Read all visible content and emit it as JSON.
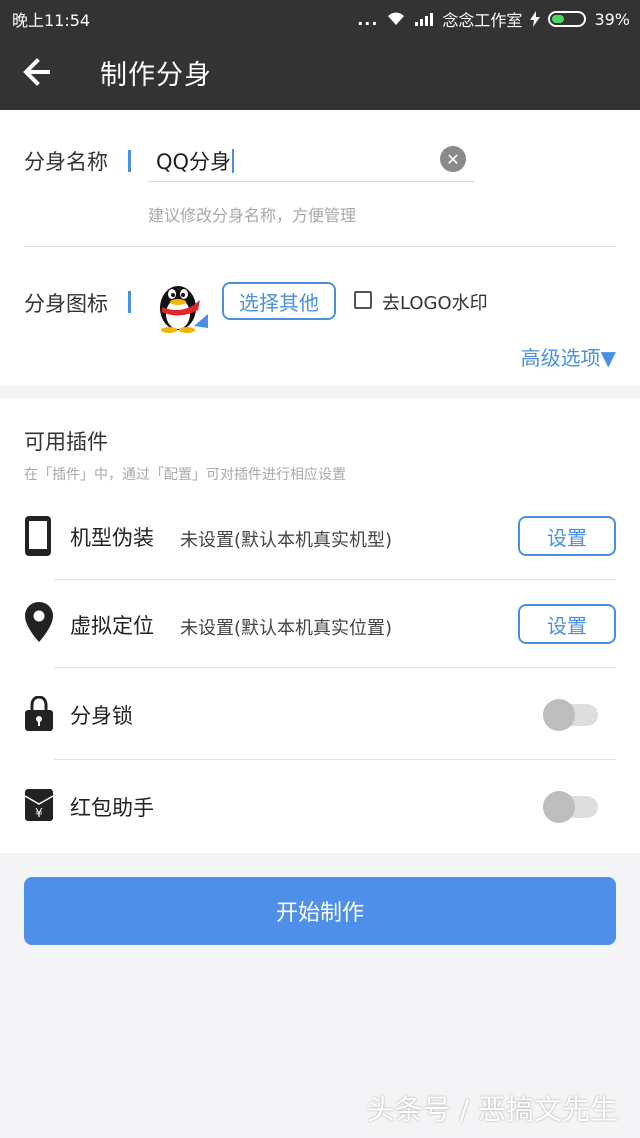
{
  "status_bar": {
    "time": "晚上11:54",
    "signal_dots": "...",
    "carrier": "念念工作室",
    "battery": "39%"
  },
  "app_bar": {
    "title": "制作分身",
    "back_icon": "arrow-left-icon"
  },
  "name_field": {
    "label": "分身名称",
    "value": "QQ分身",
    "hint": "建议修改分身名称，方便管理"
  },
  "icon_field": {
    "label": "分身图标",
    "choose_button": "选择其他",
    "remove_logo_label": "去LOGO水印",
    "remove_logo_checked": false
  },
  "advanced_options": "高级选项▼",
  "plugins": {
    "title": "可用插件",
    "hint": "在「插件」中，通过「配置」可对插件进行相应设置",
    "items": [
      {
        "label": "机型伪装",
        "status": "未设置(默认本机真实机型)",
        "action": "设置",
        "icon": "phone-icon"
      },
      {
        "label": "虚拟定位",
        "status": "未设置(默认本机真实位置)",
        "action": "设置",
        "icon": "location-pin-icon"
      },
      {
        "label": "分身锁",
        "toggle": false,
        "icon": "lock-icon"
      },
      {
        "label": "红包助手",
        "toggle": false,
        "icon": "red-envelope-icon"
      }
    ]
  },
  "start_button": "开始制作",
  "watermark": "头条号 / 恶搞文先生",
  "colors": {
    "app_bar": "#333333",
    "accent": "#4a90e2",
    "primary_button": "#4e8fe9",
    "background": "#f4f4f6"
  }
}
